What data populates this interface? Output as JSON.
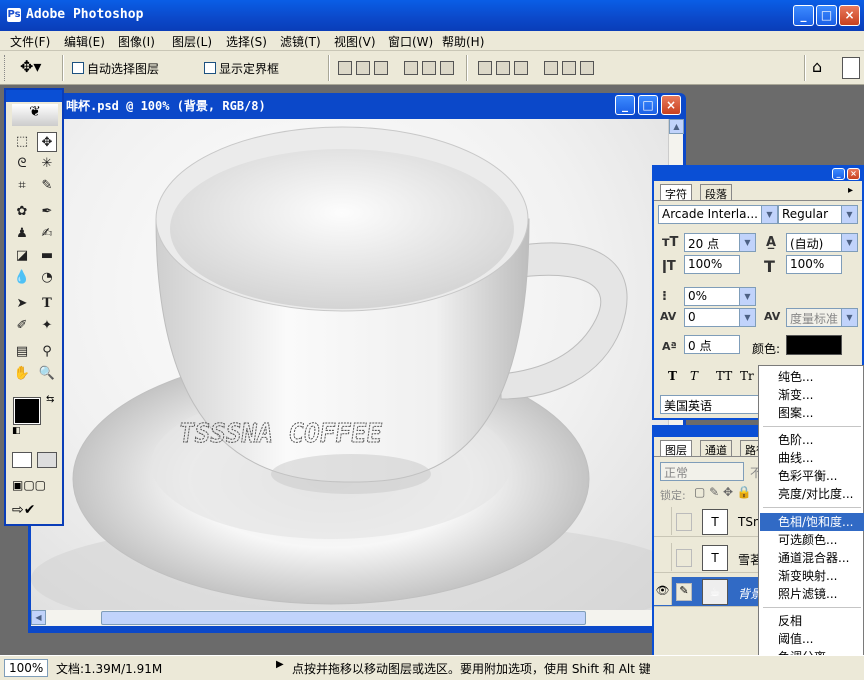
{
  "app": {
    "title": "Adobe Photoshop",
    "icon": "photoshop-icon"
  },
  "window_controls": {
    "minimize": "_",
    "maximize": "□",
    "close": "×"
  },
  "menus": [
    "文件(F)",
    "编辑(E)",
    "图像(I)",
    "图层(L)",
    "选择(S)",
    "滤镜(T)",
    "视图(V)",
    "窗口(W)",
    "帮助(H)"
  ],
  "options": {
    "auto_select": "自动选择图层",
    "show_bounds": "显示定界框"
  },
  "document": {
    "title": "啡杯.psd @ 100% (背景, RGB/8)",
    "cup_text": "TSSSNA COFFEE"
  },
  "char_panel": {
    "tabs": [
      "字符",
      "段落"
    ],
    "font_family": "Arcade Interla...",
    "font_style": "Regular",
    "size": "20 点",
    "leading": "(自动)",
    "vscale": "100%",
    "hscale": "100%",
    "tsume": "0%",
    "tracking": "0",
    "kerning": "度量标准",
    "baseline": "0 点",
    "color_label": "颜色:",
    "color": "#000000",
    "style_buttons": [
      "T",
      "T",
      "TT",
      "Tr"
    ],
    "language": "美国英语"
  },
  "layers_panel": {
    "tabs": [
      "图层",
      "通道",
      "路径"
    ],
    "blend_mode": "正常",
    "opacity": "不",
    "lock_label": "锁定:",
    "layers": [
      {
        "name": "TSn",
        "visible": false
      },
      {
        "name": "雪茗",
        "visible": false
      },
      {
        "name": "背景",
        "visible": true,
        "selected": true
      }
    ]
  },
  "context_menu": {
    "groups": [
      [
        "纯色...",
        "渐变...",
        "图案..."
      ],
      [
        "色阶...",
        "曲线...",
        "色彩平衡...",
        "亮度/对比度..."
      ],
      [
        "色相/饱和度...",
        "可选颜色...",
        "通道混合器...",
        "渐变映射...",
        "照片滤镜..."
      ],
      [
        "反相",
        "阈值...",
        "色调分离..."
      ]
    ],
    "highlighted": "色相/饱和度..."
  },
  "status": {
    "zoom": "100%",
    "doc_size": "文档:1.39M/1.91M",
    "hint": "点按并拖移以移动图层或选区。要用附加选项，使用 Shift 和 Alt 键"
  }
}
